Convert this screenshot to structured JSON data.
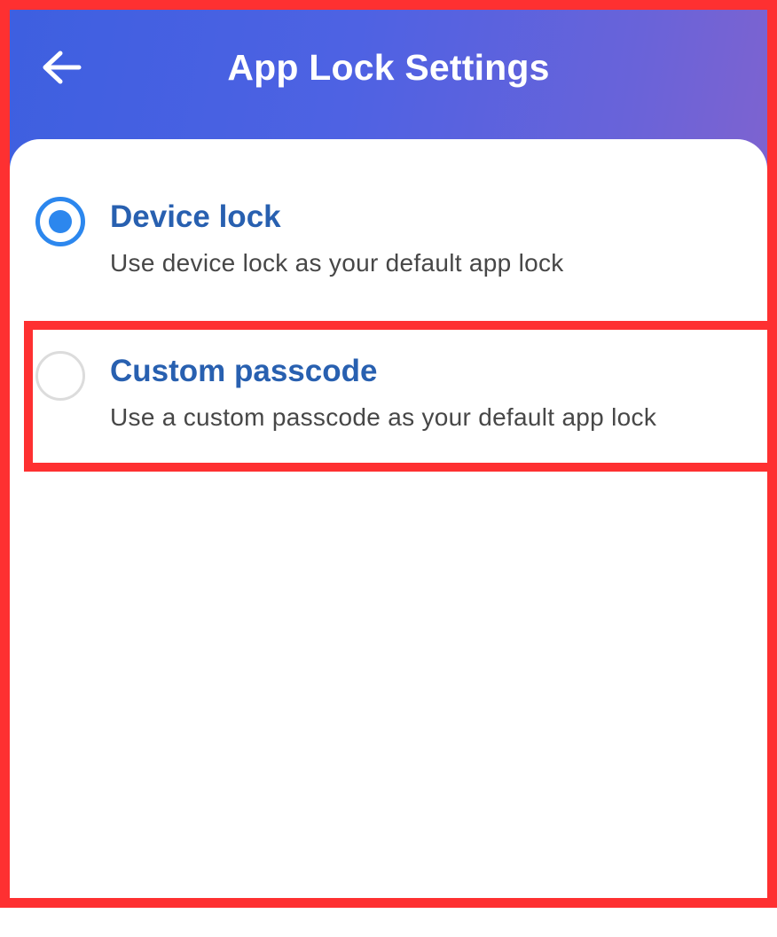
{
  "header": {
    "title": "App Lock Settings",
    "back_icon": "arrow-left-icon"
  },
  "options": [
    {
      "title": "Device lock",
      "description": "Use device lock as your default app lock",
      "selected": true
    },
    {
      "title": "Custom passcode",
      "description": "Use a custom passcode as your default app lock",
      "selected": false
    }
  ],
  "colors": {
    "header_start": "#3d5fe0",
    "header_end": "#7f63cf",
    "accent": "#2c87ee",
    "option_title": "#2860b0",
    "description": "#474747",
    "annotation_red": "#fe3031"
  }
}
